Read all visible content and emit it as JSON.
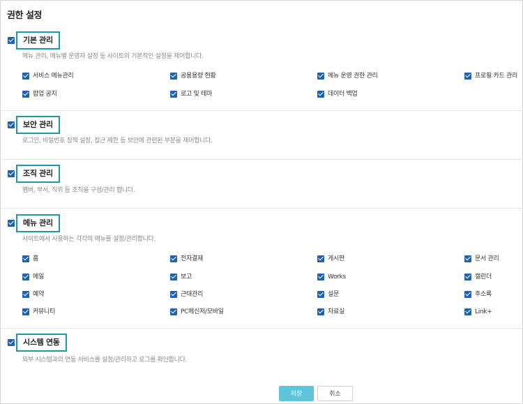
{
  "page": {
    "title": "권한 설정"
  },
  "sections": [
    {
      "title": "기본 관리",
      "description": "메뉴 관리, 메뉴별 운영자 설정 등 사이트의 기본적인 설정을 제어합니다.",
      "checked": true,
      "items": [
        {
          "label": "서비스 메뉴관리",
          "checked": true
        },
        {
          "label": "공용용량 현황",
          "checked": true
        },
        {
          "label": "메뉴 운영 권한 관리",
          "checked": true
        },
        {
          "label": "프로필 카드 관리",
          "checked": true
        },
        {
          "label": "팝업 공지",
          "checked": true
        },
        {
          "label": "로고 및 테마",
          "checked": true
        },
        {
          "label": "데이터 백업",
          "checked": true
        }
      ]
    },
    {
      "title": "보안 관리",
      "description": "로그인, 비밀번호 정책 설정, 접근 제한 등 보안에 관련된 부분을 제어합니다.",
      "checked": true,
      "items": []
    },
    {
      "title": "조직 관리",
      "description": "멤버, 부서, 직위 등 조직을 구성/관리 합니다.",
      "checked": true,
      "items": []
    },
    {
      "title": "메뉴 관리",
      "description": "사이트에서 사용하는 각각의 메뉴를 설정/관리합니다.",
      "checked": true,
      "items": [
        {
          "label": "홈",
          "checked": true
        },
        {
          "label": "전자결재",
          "checked": true
        },
        {
          "label": "게시판",
          "checked": true
        },
        {
          "label": "문서 관리",
          "checked": true
        },
        {
          "label": "메일",
          "checked": true
        },
        {
          "label": "보고",
          "checked": true
        },
        {
          "label": "Works",
          "checked": true
        },
        {
          "label": "캘린더",
          "checked": true
        },
        {
          "label": "예약",
          "checked": true
        },
        {
          "label": "근태관리",
          "checked": true
        },
        {
          "label": "설문",
          "checked": true
        },
        {
          "label": "주소록",
          "checked": true
        },
        {
          "label": "커뮤니티",
          "checked": true
        },
        {
          "label": "PC메신저/모바일",
          "checked": true
        },
        {
          "label": "자료실",
          "checked": true
        },
        {
          "label": "Link+",
          "checked": true
        }
      ]
    },
    {
      "title": "시스템 연동",
      "description": "외부 시스템과의 연동 서비스를 설정/관리하고 로그를 확인합니다.",
      "checked": true,
      "items": []
    }
  ],
  "buttons": {
    "save": "저장",
    "cancel": "취소"
  },
  "colors": {
    "accent_border": "#1a9aa6",
    "checkbox": "#1d62b7",
    "save_button": "#5fc5dd"
  }
}
